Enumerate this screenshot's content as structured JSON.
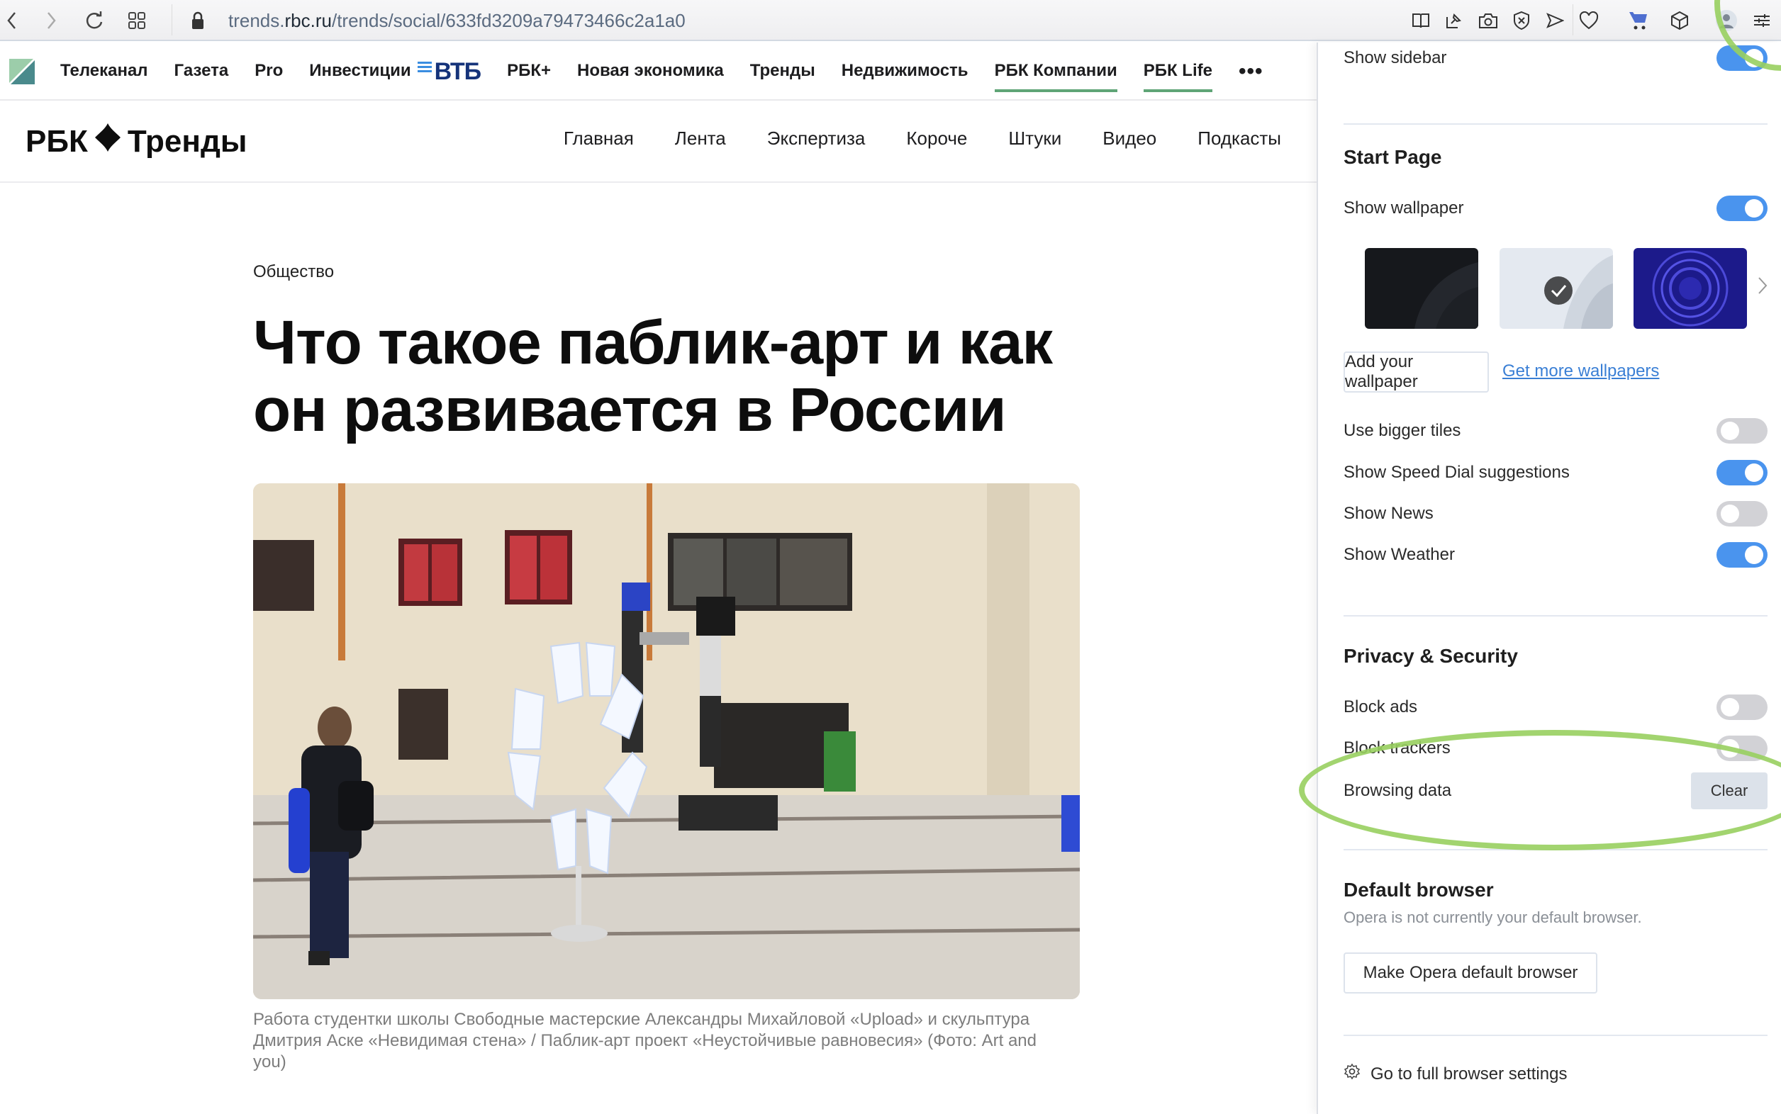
{
  "browser": {
    "url_host": "trends.rbc.ru",
    "url_host_plain": "trends.",
    "url_host_bold": "rbc.ru",
    "url_path": "/trends/social/633fd3209a79473466c2a1a0",
    "toolbar_icons": [
      "back-icon",
      "forward-icon",
      "reload-icon",
      "tabs-grid-icon",
      "lock-icon",
      "reader-icon",
      "pin-icon",
      "snapshot-icon",
      "adblock-shield-icon",
      "send-icon",
      "heart-icon",
      "cart-icon",
      "box-icon",
      "profile-avatar",
      "easy-setup-icon"
    ]
  },
  "topnav": {
    "items": [
      {
        "label": "Телеканал"
      },
      {
        "label": "Газета"
      },
      {
        "label": "Pro"
      },
      {
        "label": "Инвестиции"
      },
      {
        "label": "ВТБ"
      },
      {
        "label": "РБК+"
      },
      {
        "label": "Новая экономика"
      },
      {
        "label": "Тренды"
      },
      {
        "label": "Недвижимость"
      },
      {
        "label": "РБК Компании",
        "underlined": true
      },
      {
        "label": "РБК Life",
        "underlined": true
      }
    ],
    "more_label": "•••",
    "accent_color": "#5fa476"
  },
  "site": {
    "brand_left": "РБК",
    "brand_right": "Тренды",
    "nav": [
      "Главная",
      "Лента",
      "Экспертиза",
      "Короче",
      "Штуки",
      "Видео",
      "Подкасты"
    ]
  },
  "article": {
    "category": "Общество",
    "title": "Что такое паблик-арт и как он развивается в России",
    "caption": "Работа студентки школы Свободные мастерские Александры Михайловой «Upload» и скульптура Дмитрия Аске «Невидимая стена» / Паблик-арт проект «Неустойчивые равновесия» (Фото: Art and you)"
  },
  "panel": {
    "show_sidebar": {
      "label": "Show sidebar",
      "on": true
    },
    "start_page": {
      "title": "Start Page",
      "show_wallpaper": {
        "label": "Show wallpaper",
        "on": true
      },
      "wallpapers": [
        {
          "name": "dark-waves",
          "selected": false
        },
        {
          "name": "light-waves",
          "selected": true
        },
        {
          "name": "blue-rings",
          "selected": false
        }
      ],
      "add_wallpaper": "Add your wallpaper",
      "get_more": "Get more wallpapers",
      "toggles": [
        {
          "label": "Use bigger tiles",
          "on": false
        },
        {
          "label": "Show Speed Dial suggestions",
          "on": true
        },
        {
          "label": "Show News",
          "on": false
        },
        {
          "label": "Show Weather",
          "on": true
        }
      ]
    },
    "privacy": {
      "title": "Privacy & Security",
      "block_ads": {
        "label": "Block ads",
        "on": false
      },
      "block_trackers": {
        "label": "Block trackers",
        "on": false
      },
      "browsing_data": {
        "label": "Browsing data",
        "button": "Clear"
      }
    },
    "default_browser": {
      "title": "Default browser",
      "status": "Opera is not currently your default browser.",
      "button": "Make Opera default browser"
    },
    "full_settings": "Go to full browser settings",
    "toggle_on_color": "#4a94ee",
    "annotation_color": "#98cf5f"
  }
}
